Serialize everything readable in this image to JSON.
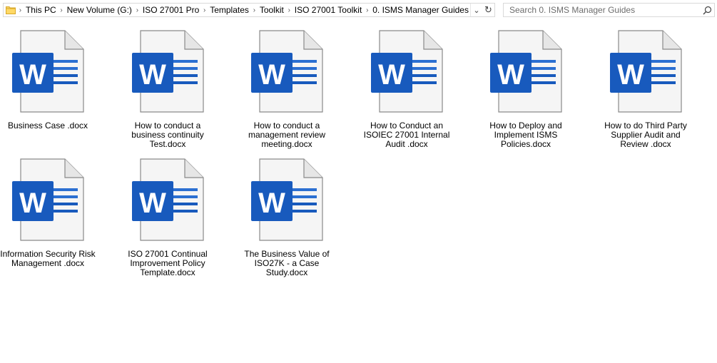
{
  "address": {
    "crumbs": [
      "This PC",
      "New Volume (G:)",
      "ISO 27001 Pro",
      "Templates",
      "Toolkit",
      "ISO 27001 Toolkit",
      "0. ISMS Manager Guides"
    ]
  },
  "search": {
    "placeholder": "Search 0. ISMS Manager Guides"
  },
  "icons": {
    "folder": "folder-icon",
    "chevron": "chevron-right-icon",
    "dropdown": "chevron-down-icon",
    "refresh": "refresh-icon",
    "search": "search-icon",
    "file": "word-document-icon"
  },
  "colors": {
    "word_blue": "#185abd",
    "word_lines": "#2b6fd1",
    "page": "#f5f5f5"
  },
  "files": [
    {
      "name": "Business Case .docx"
    },
    {
      "name": "How to conduct a business continuity Test.docx"
    },
    {
      "name": "How to conduct a management review meeting.docx"
    },
    {
      "name": "How to Conduct an ISOIEC 27001 Internal Audit .docx"
    },
    {
      "name": "How to Deploy and Implement ISMS Policies.docx"
    },
    {
      "name": "How to do Third Party Supplier Audit and Review .docx"
    },
    {
      "name": "Information Security Risk Management .docx"
    },
    {
      "name": "ISO 27001 Continual Improvement Policy Template.docx"
    },
    {
      "name": "The Business Value of ISO27K - a Case Study.docx"
    }
  ]
}
